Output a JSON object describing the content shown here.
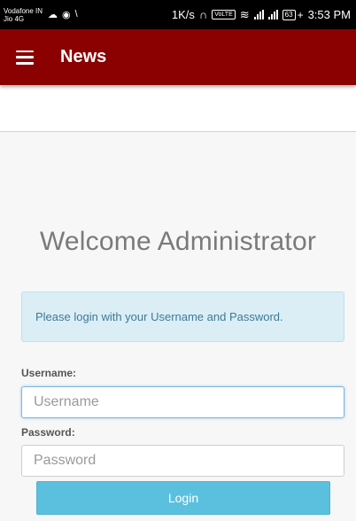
{
  "status_bar": {
    "carrier_primary": "Vodafone IN",
    "carrier_secondary": "Jio 4G",
    "network_speed": "1K/s",
    "volte_badge": "VoLTE",
    "battery_level": "63",
    "charging_symbol": "+",
    "time": "3:53 PM"
  },
  "app_bar": {
    "title": "News",
    "color": "#8b0000"
  },
  "login": {
    "heading": "Welcome Administrator",
    "info_message": "Please login with your Username and Password.",
    "username_label": "Username:",
    "username_placeholder": "Username",
    "username_value": "",
    "password_label": "Password:",
    "password_placeholder": "Password",
    "password_value": "",
    "login_button_label": "Login",
    "button_color": "#5bc0de"
  }
}
